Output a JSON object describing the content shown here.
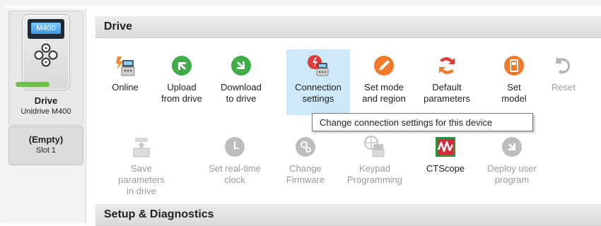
{
  "sidebar": {
    "drive": {
      "screen_text": "M400",
      "name": "Drive",
      "model": "Unidrive M400"
    },
    "slot": {
      "title": "(Empty)",
      "subtitle": "Slot 1"
    }
  },
  "sections": [
    {
      "title": "Drive"
    },
    {
      "title": "Setup & Diagnostics"
    }
  ],
  "tools_row1": [
    {
      "label": "Online",
      "icon": "online-plug-icon",
      "enabled": true
    },
    {
      "label": "Upload\nfrom drive",
      "icon": "upload-arrow-icon",
      "enabled": true
    },
    {
      "label": "Download\nto drive",
      "icon": "download-arrow-icon",
      "enabled": true
    },
    {
      "label": "Connection\nsettings",
      "icon": "connection-settings-icon",
      "enabled": true,
      "highlighted": true
    },
    {
      "label": "Set mode\nand region",
      "icon": "set-mode-icon",
      "enabled": true
    },
    {
      "label": "Default\nparameters",
      "icon": "default-parameters-icon",
      "enabled": true
    },
    {
      "label": "Set\nmodel",
      "icon": "set-model-icon",
      "enabled": true
    },
    {
      "label": "Reset",
      "icon": "reset-icon",
      "enabled": false
    }
  ],
  "tools_row2": [
    {
      "label": "Save parameters\nin drive",
      "icon": "save-parameters-icon",
      "enabled": false
    },
    {
      "label": "Set real-time\nclock",
      "icon": "clock-icon",
      "enabled": false
    },
    {
      "label": "Change\nFirmware",
      "icon": "firmware-icon",
      "enabled": false
    },
    {
      "label": "Keypad\nProgramming",
      "icon": "keypad-programming-icon",
      "enabled": false
    },
    {
      "label": "CTScope",
      "icon": "ctscope-icon",
      "enabled": true
    },
    {
      "label": "Deploy user\nprogram",
      "icon": "deploy-program-icon",
      "enabled": false
    }
  ],
  "tooltip": {
    "text": "Change connection settings for this device"
  },
  "colors": {
    "green": "#3fae49",
    "orange": "#f07a2a",
    "red": "#e53935",
    "highlight": "#cde8f7"
  }
}
